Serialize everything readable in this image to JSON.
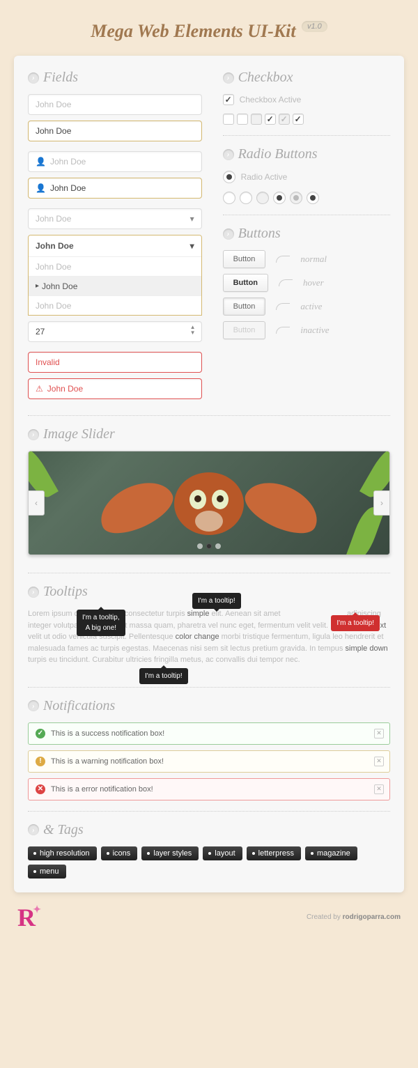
{
  "header": {
    "title": "Mega Web Elements UI-Kit",
    "version": "v1.0"
  },
  "sections": {
    "fields": "Fields",
    "checkbox": "Checkbox",
    "radio": "Radio Buttons",
    "buttons": "Buttons",
    "slider": "Image Slider",
    "tooltips": "Tooltips",
    "notifications": "Notifications",
    "tags": "& Tags"
  },
  "fields": {
    "placeholder1": "John Doe",
    "active1": "John Doe",
    "icon_placeholder": "John Doe",
    "icon_active": "John Doe",
    "select_placeholder": "John Doe",
    "select_active": "John Doe",
    "dropdown_opts": [
      "John Doe",
      "John Doe",
      "John Doe"
    ],
    "stepper_value": "27",
    "invalid_label": "Invalid",
    "invalid_icon": "John Doe"
  },
  "checkbox": {
    "active_label": "Checkbox Active"
  },
  "radio": {
    "active_label": "Radio Active"
  },
  "buttons": {
    "label": "Button",
    "states": {
      "normal": "normal",
      "hover": "hover",
      "active": "active",
      "inactive": "inactive"
    }
  },
  "tooltips": {
    "big": "I'm a tooltip,\nA big one!",
    "simple": "I'm a tooltip!",
    "red": "I'm a tooltip!",
    "down": "I'm a tooltip!",
    "keywords": {
      "simple": "simple",
      "large": "large text",
      "color": "color change",
      "sdown": "simple down"
    },
    "lorem": "Lorem ipsum dolor sit amet, consectetur turpis ",
    "lorem2": " elit. Aenean sit amet ",
    "lorem3": " adipiscing integer volutpat quis dolor. Ut massa quam, pharetra vel nunc eget, fermentum velit velit. Donec ",
    "lorem4": " velit ut odio vehicula suscipit. Pellentesque ",
    "lorem5": " morbi tristique fermentum, ligula leo hendrerit et malesuada fames ac turpis egestas. Maecenas nisi sem sit lectus pretium gravida. In tempus ",
    "lorem6": " turpis eu tincidunt. Curabitur ultricies fringilla metus, ac convallis dui tempor nec."
  },
  "notifications": {
    "success": "This is a success notification box!",
    "warning": "This is a warning notification box!",
    "error": "This is a error notification box!"
  },
  "tags": [
    "high resolution",
    "icons",
    "layer styles",
    "layout",
    "letterpress",
    "magazine",
    "menu"
  ],
  "footer": {
    "created": "Created by",
    "author": "rodrigoparra.com"
  }
}
